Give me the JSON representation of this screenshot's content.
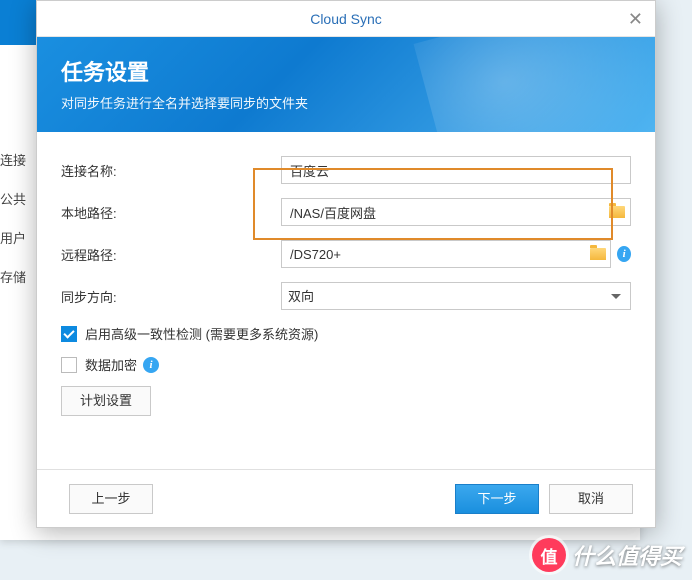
{
  "title": "Cloud Sync",
  "banner": {
    "heading": "任务设置",
    "subtitle": "对同步任务进行全名并选择要同步的文件夹"
  },
  "labels": {
    "conn_name": "连接名称:",
    "local_path": "本地路径:",
    "remote_path": "远程路径:",
    "direction": "同步方向:"
  },
  "values": {
    "conn_name": "百度云",
    "local_path": "/NAS/百度网盘",
    "remote_path": "/DS720+",
    "direction": "双向"
  },
  "checkboxes": {
    "consistency": {
      "label": "启用高级一致性检测 (需要更多系统资源)",
      "checked": true
    },
    "encrypt": {
      "label": "数据加密",
      "checked": false
    }
  },
  "buttons": {
    "schedule": "计划设置",
    "back": "上一步",
    "next": "下一步",
    "cancel": "取消"
  },
  "bg_sidebar": [
    "连接",
    "公共",
    "用户",
    "存储"
  ],
  "watermark": {
    "badge": "值",
    "text": "什么值得买"
  }
}
